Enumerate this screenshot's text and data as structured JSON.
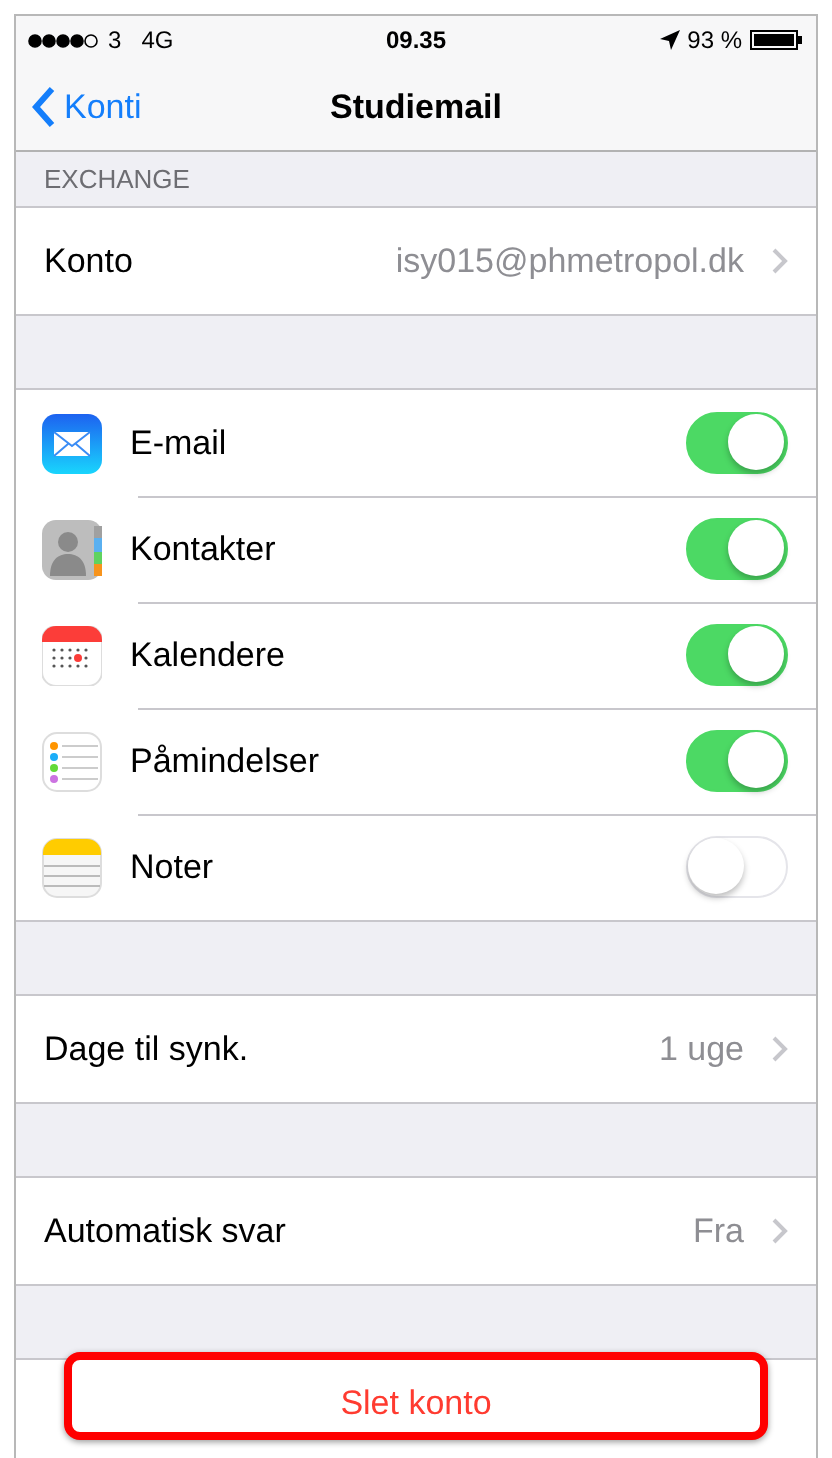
{
  "status_bar": {
    "carrier": "3",
    "network": "4G",
    "time": "09.35",
    "battery": "93 %"
  },
  "nav": {
    "back": "Konti",
    "title": "Studiemail"
  },
  "section_header": "EXCHANGE",
  "account": {
    "label": "Konto",
    "value": "isy015@phmetropol.dk"
  },
  "services": [
    {
      "kind": "mail",
      "label": "E-mail",
      "on": true
    },
    {
      "kind": "contacts",
      "label": "Kontakter",
      "on": true
    },
    {
      "kind": "calendar",
      "label": "Kalendere",
      "on": true
    },
    {
      "kind": "reminders",
      "label": "Påmindelser",
      "on": true
    },
    {
      "kind": "notes",
      "label": "Noter",
      "on": false
    }
  ],
  "sync": {
    "label": "Dage til synk.",
    "value": "1 uge"
  },
  "auto_reply": {
    "label": "Automatisk svar",
    "value": "Fra"
  },
  "delete_button": "Slet konto"
}
